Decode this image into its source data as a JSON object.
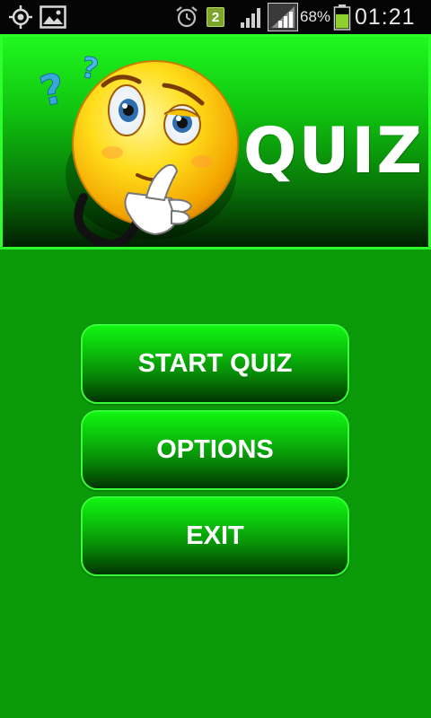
{
  "status_bar": {
    "icons": [
      "gps-icon",
      "image-notification-icon",
      "alarm-icon",
      "notification-badge",
      "signal-icon",
      "signal-icon",
      "battery-icon"
    ],
    "notification_count": "2",
    "battery_percent": "68%",
    "battery_level": 0.68,
    "time": "01:21"
  },
  "header": {
    "title": "QUIZ",
    "mascot": "thinking-face-with-question-marks"
  },
  "menu": {
    "start_label": "START QUIZ",
    "options_label": "OPTIONS",
    "exit_label": "EXIT"
  },
  "colors": {
    "background": "#0a9a0a",
    "button_border": "#35ff35",
    "status_bar": "#050505"
  }
}
